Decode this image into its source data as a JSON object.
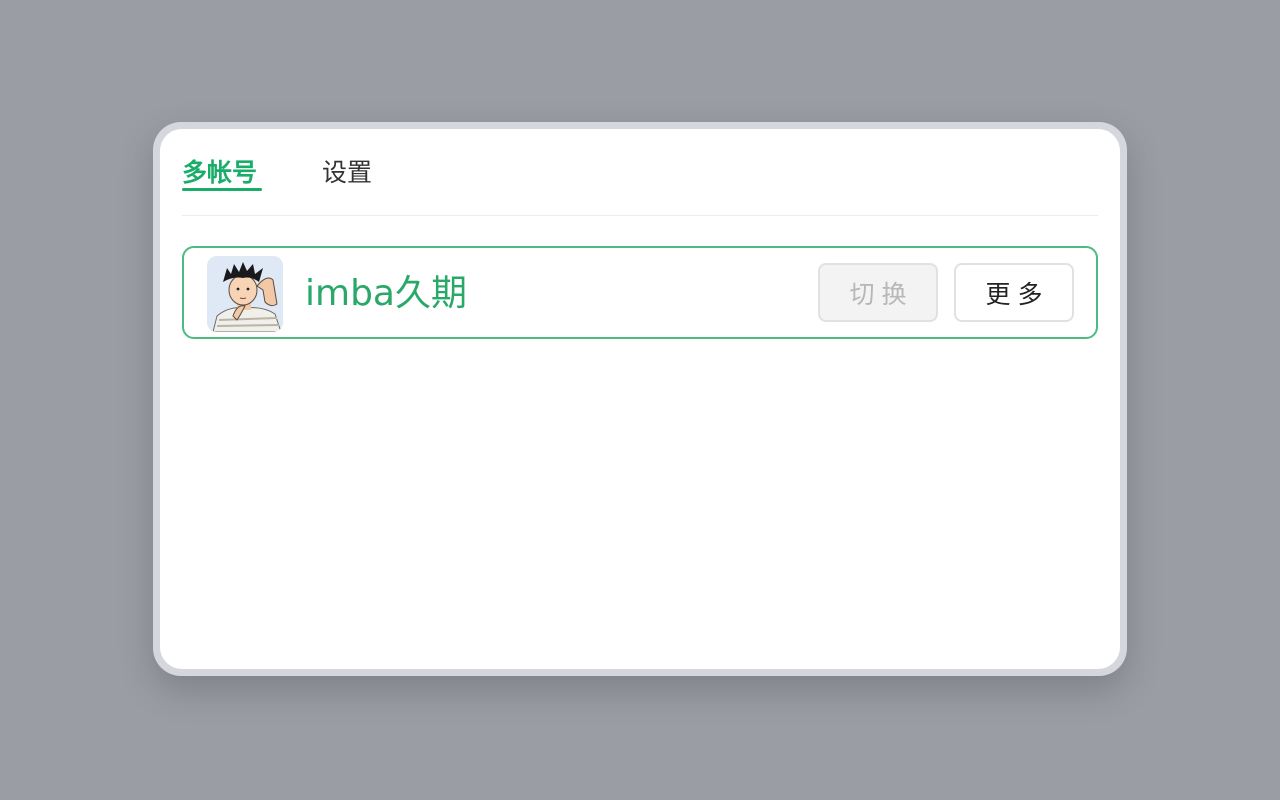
{
  "tabs": [
    {
      "label": "多帐号",
      "active": true
    },
    {
      "label": "设置",
      "active": false
    }
  ],
  "account": {
    "name": "imba久期",
    "avatar_icon": "user-avatar-image"
  },
  "buttons": {
    "switch_label": "切换",
    "more_label": "更多"
  },
  "colors": {
    "accent": "#1aad6a",
    "card_border": "#4cbb7f",
    "background": "#9a9da4",
    "disabled_text": "#b7b7b7"
  }
}
